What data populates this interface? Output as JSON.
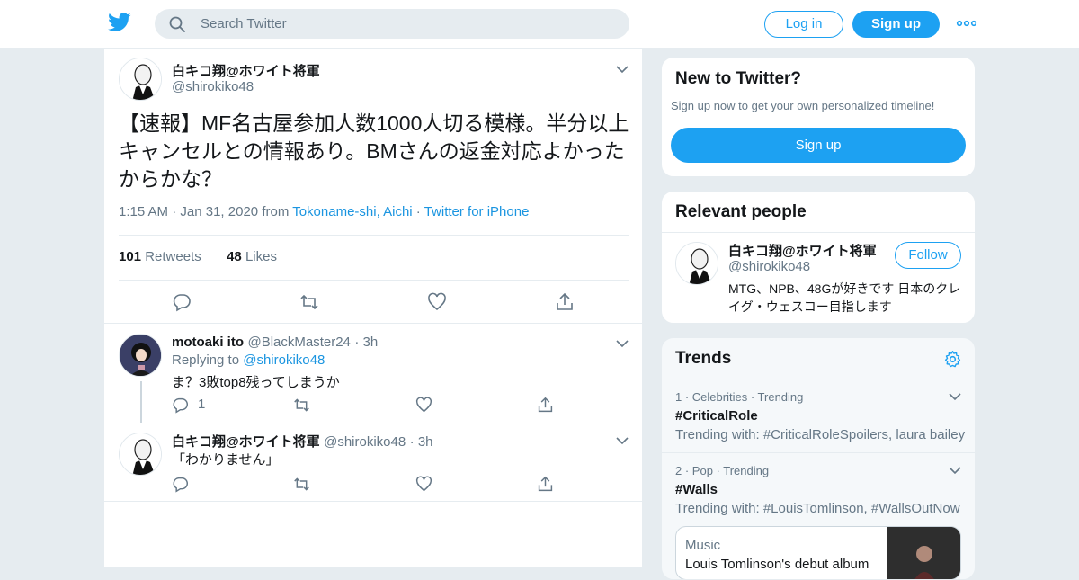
{
  "header": {
    "search_placeholder": "Search Twitter",
    "login_label": "Log in",
    "signup_label": "Sign up",
    "brand_color": "#1da1f2"
  },
  "main_tweet": {
    "name": "白キコ翔@ホワイト将軍",
    "handle": "@shirokiko48",
    "text": "【速報】MF名古屋参加人数1000人切る模様。半分以上キャンセルとの情報あり。BMさんの返金対応よかったからかな？",
    "time": "1:15 AM",
    "date": "Jan 31, 2020",
    "from_label": "from",
    "location": "Tokoname-shi, Aichi",
    "client": "Twitter for iPhone",
    "retweets_count": "101",
    "retweets_label": "Retweets",
    "likes_count": "48",
    "likes_label": "Likes"
  },
  "replies": [
    {
      "name": "motoaki ito",
      "handle": "@BlackMaster24",
      "time": "3h",
      "replying_label": "Replying to",
      "replying_to": "@shirokiko48",
      "text": "ま？3敗top8残ってしまうか",
      "reply_count": "1"
    },
    {
      "name": "白キコ翔@ホワイト将軍",
      "handle": "@shirokiko48",
      "time": "3h",
      "text": "「わかりません」"
    }
  ],
  "sidebar": {
    "new_to_twitter": {
      "title": "New to Twitter?",
      "subtitle": "Sign up now to get your own personalized timeline!",
      "button": "Sign up"
    },
    "relevant_people": {
      "title": "Relevant people",
      "name": "白キコ翔@ホワイト将軍",
      "handle": "@shirokiko48",
      "follow_label": "Follow",
      "bio": "MTG、NPB、48Gが好きです 日本のクレイグ・ウェスコー目指します"
    },
    "trends": {
      "title": "Trends",
      "items": [
        {
          "rank": "1",
          "category": "Celebrities",
          "status": "Trending",
          "name": "#CriticalRole",
          "with": "Trending with: #CriticalRoleSpoilers, laura bailey"
        },
        {
          "rank": "2",
          "category": "Pop",
          "status": "Trending",
          "name": "#Walls",
          "with": "Trending with: #LouisTomlinson, #WallsOutNow"
        }
      ],
      "card": {
        "category": "Music",
        "headline": "Louis Tomlinson's debut album"
      }
    }
  }
}
